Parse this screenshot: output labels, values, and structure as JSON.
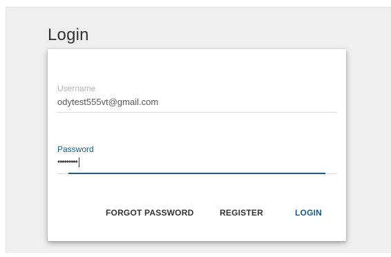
{
  "page": {
    "title": "Login"
  },
  "form": {
    "username": {
      "label": "Username",
      "value": "odytest555vt@gmail.com"
    },
    "password": {
      "label": "Password",
      "value": "•••••••••"
    }
  },
  "actions": {
    "forgot_password": "FORGOT PASSWORD",
    "register": "REGISTER",
    "login": "LOGIN"
  },
  "colors": {
    "accent": "#1c5a8a",
    "panel_background": "#efefef",
    "card_background": "#ffffff",
    "muted_label": "#b3b3b3"
  }
}
